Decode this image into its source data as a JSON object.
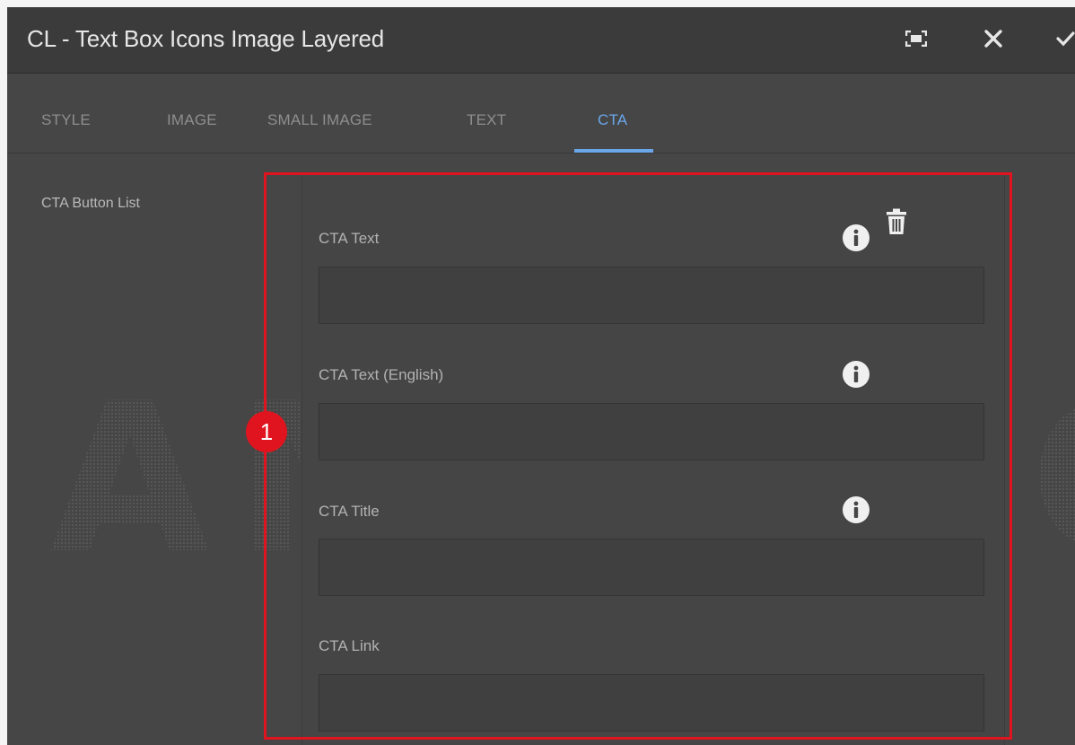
{
  "dialog": {
    "title": "CL - Text Box Icons Image Layered",
    "actions": [
      "fullscreen-icon",
      "close-icon",
      "check-icon"
    ]
  },
  "tabs": [
    {
      "label": "STYLE",
      "active": false
    },
    {
      "label": "IMAGE",
      "active": false
    },
    {
      "label": "SMALL IMAGE",
      "active": false
    },
    {
      "label": "TEXT",
      "active": false
    },
    {
      "label": "CTA",
      "active": true
    }
  ],
  "cta": {
    "section_label": "CTA Button List",
    "fields": [
      {
        "label": "CTA Text",
        "value": ""
      },
      {
        "label": "CTA Text (English)",
        "value": ""
      },
      {
        "label": "CTA Title",
        "value": ""
      },
      {
        "label": "CTA Link",
        "value": ""
      }
    ]
  },
  "annotation": {
    "badge": "1"
  },
  "watermark": {
    "text": "SAMSUNG"
  },
  "colors": {
    "accent": "#6aa6e8",
    "highlight": "#e0141e",
    "dialog_bg": "#464646"
  }
}
